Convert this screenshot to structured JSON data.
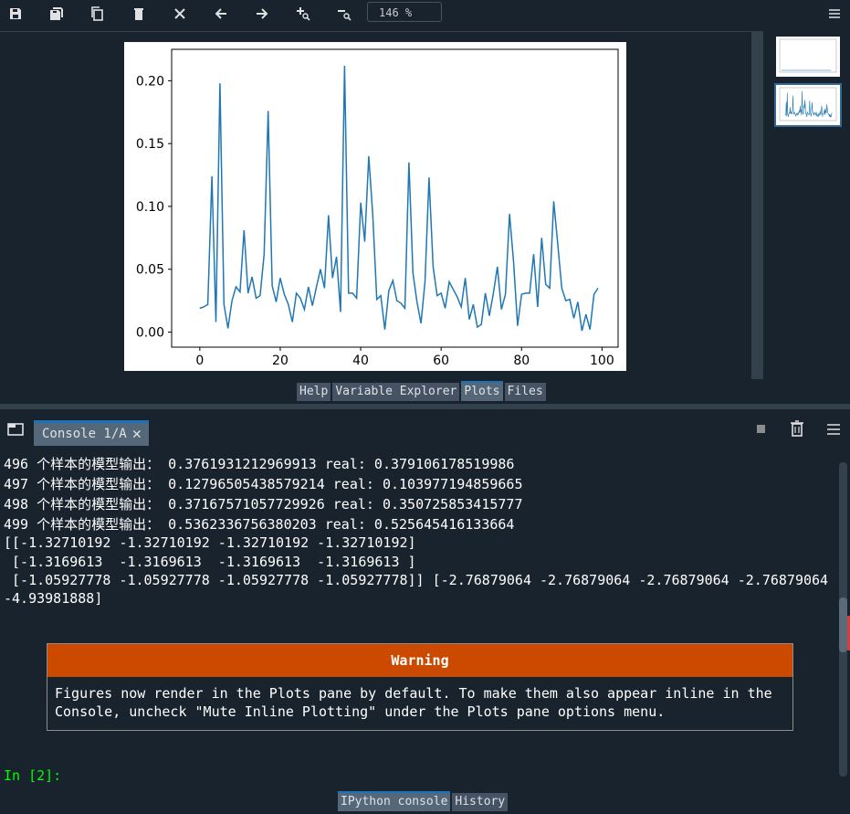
{
  "toolbar": {
    "icons": [
      "save-icon",
      "save-all-icon",
      "copy-icon",
      "delete-icon",
      "delete-all-icon",
      "previous-icon",
      "next-icon",
      "zoom-in-icon",
      "zoom-out-icon"
    ],
    "zoom_value": "146 %",
    "menu_icon": "hamburger-menu-icon"
  },
  "plots": {
    "chart_data": {
      "type": "line",
      "color": "#1f77b4",
      "xlim": [
        -7,
        104
      ],
      "ylim": [
        -0.012,
        0.225
      ],
      "x_ticks": [
        "0",
        "20",
        "40",
        "60",
        "80",
        "100"
      ],
      "y_ticks": [
        "0.00",
        "0.05",
        "0.10",
        "0.15",
        "0.20"
      ],
      "x": [
        0,
        1,
        2,
        3,
        4,
        5,
        6,
        7,
        8,
        9,
        10,
        11,
        12,
        13,
        14,
        15,
        16,
        17,
        18,
        19,
        20,
        21,
        22,
        23,
        24,
        25,
        26,
        27,
        28,
        29,
        30,
        31,
        32,
        33,
        34,
        35,
        36,
        37,
        38,
        39,
        40,
        41,
        42,
        43,
        44,
        45,
        46,
        47,
        48,
        49,
        50,
        51,
        52,
        53,
        54,
        55,
        56,
        57,
        58,
        59,
        60,
        61,
        62,
        63,
        64,
        65,
        66,
        67,
        68,
        69,
        70,
        71,
        72,
        73,
        74,
        75,
        76,
        77,
        78,
        79,
        80,
        81,
        82,
        83,
        84,
        85,
        86,
        87,
        88,
        89,
        90,
        91,
        92,
        93,
        94,
        95,
        96,
        97,
        98,
        99
      ],
      "values": [
        0.019,
        0.02,
        0.022,
        0.124,
        0.008,
        0.198,
        0.022,
        0.003,
        0.025,
        0.036,
        0.032,
        0.081,
        0.031,
        0.044,
        0.027,
        0.029,
        0.062,
        0.176,
        0.037,
        0.024,
        0.043,
        0.03,
        0.022,
        0.008,
        0.031,
        0.027,
        0.018,
        0.036,
        0.021,
        0.036,
        0.05,
        0.035,
        0.093,
        0.043,
        0.06,
        0.016,
        0.212,
        0.031,
        0.031,
        0.027,
        0.103,
        0.072,
        0.14,
        0.093,
        0.026,
        0.029,
        0.002,
        0.033,
        0.041,
        0.025,
        0.023,
        0.019,
        0.135,
        0.047,
        0.024,
        0.007,
        0.04,
        0.123,
        0.052,
        0.029,
        0.031,
        0.019,
        0.04,
        0.034,
        0.028,
        0.02,
        0.043,
        0.01,
        0.022,
        0.004,
        0.006,
        0.031,
        0.013,
        0.031,
        0.052,
        0.018,
        0.03,
        0.094,
        0.056,
        0.005,
        0.03,
        0.031,
        0.031,
        0.062,
        0.02,
        0.075,
        0.038,
        0.035,
        0.104,
        0.07,
        0.035,
        0.025,
        0.026,
        0.011,
        0.024,
        0.001,
        0.014,
        0.002,
        0.03,
        0.035
      ]
    },
    "thumbnails": [
      "thumbnail-plot-1",
      "thumbnail-plot-2"
    ]
  },
  "pane_tabs": [
    {
      "label": "Help",
      "active": false
    },
    {
      "label": "Variable Explorer",
      "active": false
    },
    {
      "label": "Plots",
      "active": true
    },
    {
      "label": "Files",
      "active": false
    }
  ],
  "console": {
    "tab_label": "Console 1/A",
    "close_symbol": "✕",
    "lines": [
      "496 个样本的模型输出： 0.3761931212969913 real: 0.379106178519986",
      "497 个样本的模型输出： 0.12796505438579214 real: 0.103977194859665",
      "498 个样本的模型输出： 0.37167571057729926 real: 0.350725853415777",
      "499 个样本的模型输出： 0.5362336756380203 real: 0.525645416133664",
      "[[-1.32710192 -1.32710192 -1.32710192 -1.32710192]",
      " [-1.3169613  -1.3169613  -1.3169613  -1.3169613 ]",
      " [-1.05927778 -1.05927778 -1.05927778 -1.05927778]] [-2.76879064 -2.76879064 -2.76879064 -2.76879064",
      "-4.93981888]"
    ],
    "warning": {
      "title": "Warning",
      "text": "Figures now render in the Plots pane by default. To make them also appear inline in the\nConsole, uncheck \"Mute Inline Plotting\" under the Plots pane options menu."
    },
    "prompt": "In [2]:"
  },
  "bottom_tabs": [
    {
      "label": "IPython console",
      "active": true
    },
    {
      "label": "History",
      "active": false
    }
  ]
}
